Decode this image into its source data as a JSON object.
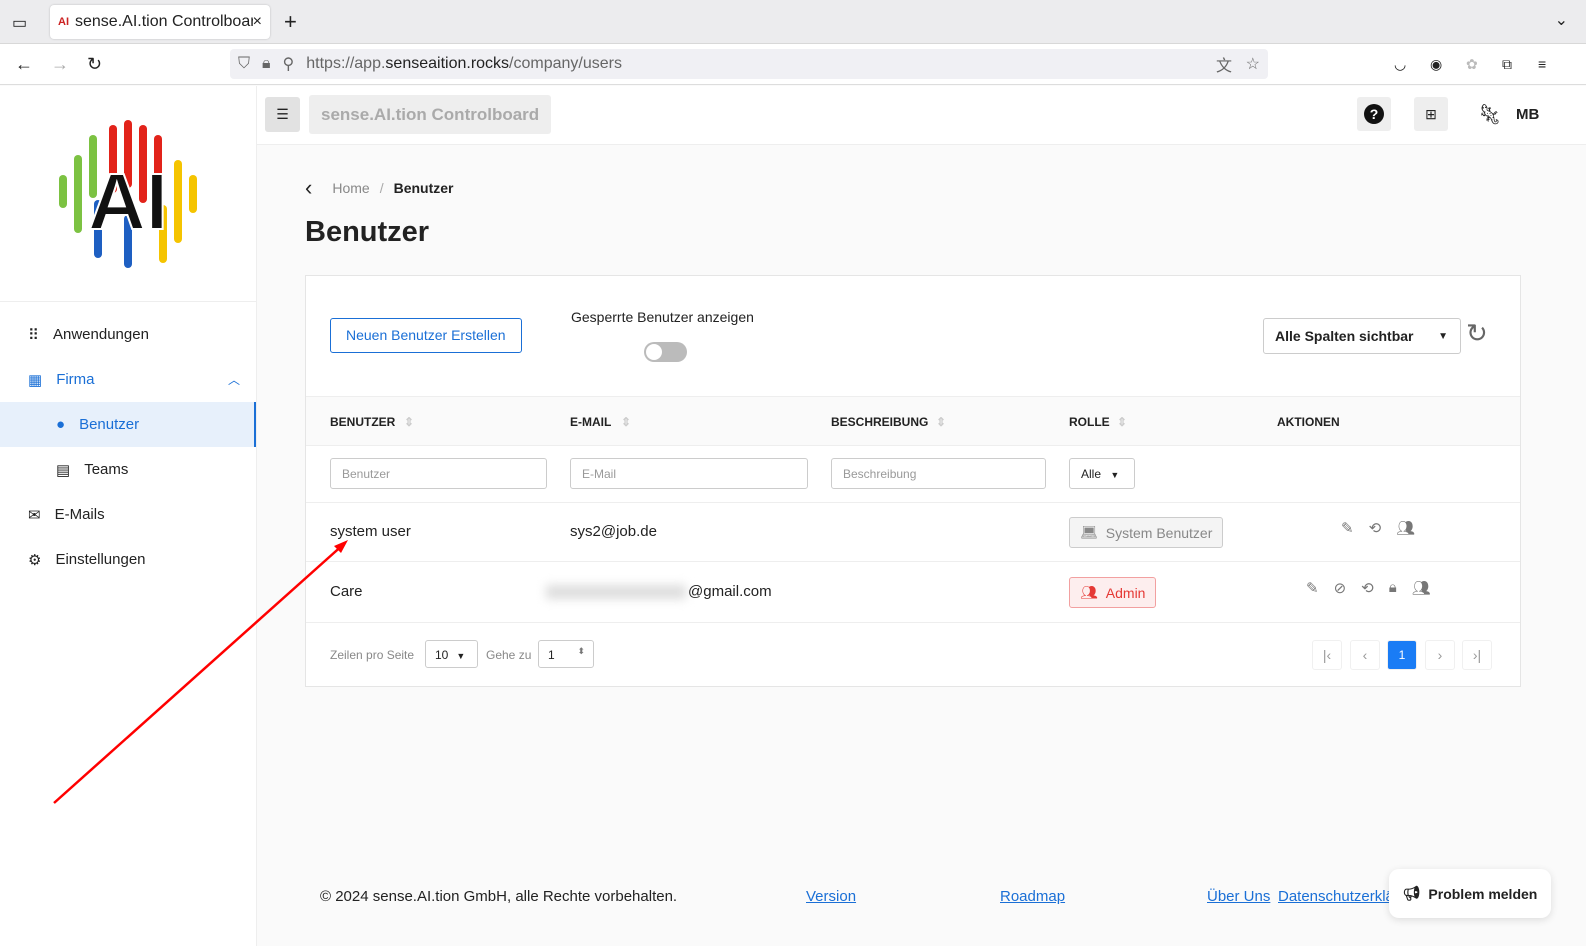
{
  "browser": {
    "tab_title": "sense.AI.tion Controlboard",
    "url_prefix": "https://app.",
    "url_domain": "senseaition.rocks",
    "url_path": "/company/users"
  },
  "header": {
    "app_title": "sense.AI.tion Controlboard",
    "user_initials": "MB"
  },
  "sidebar": {
    "logo_text": "AI",
    "items": [
      {
        "label": "Anwendungen",
        "icon": "apps-icon"
      },
      {
        "label": "Firma",
        "icon": "building-icon"
      },
      {
        "label": "Benutzer",
        "icon": "person-icon"
      },
      {
        "label": "Teams",
        "icon": "list-icon"
      },
      {
        "label": "E-Mails",
        "icon": "mail-icon"
      },
      {
        "label": "Einstellungen",
        "icon": "gear-icon"
      }
    ]
  },
  "breadcrumb": {
    "home": "Home",
    "sep": "/",
    "current": "Benutzer"
  },
  "page_title": "Benutzer",
  "toolbar": {
    "create_button": "Neuen Benutzer Erstellen",
    "toggle_label": "Gesperrte Benutzer anzeigen",
    "toggle_on": false,
    "columns_select": "Alle Spalten sichtbar"
  },
  "table": {
    "headers": [
      "BENUTZER",
      "E-MAIL",
      "BESCHREIBUNG",
      "ROLLE",
      "AKTIONEN"
    ],
    "filters": {
      "user": "Benutzer",
      "email": "E-Mail",
      "description": "Beschreibung",
      "role": "Alle"
    },
    "rows": [
      {
        "user": "system user",
        "email": "sys2@job.de",
        "role": "System Benutzer"
      },
      {
        "user": "Care",
        "email": "@gmail.com",
        "role": "Admin"
      }
    ]
  },
  "pagination": {
    "rows_label": "Zeilen pro Seite",
    "rows_value": "10",
    "goto_label": "Gehe zu",
    "goto_value": "1",
    "current_page": "1"
  },
  "footer": {
    "copyright": "© 2024 sense.AI.tion GmbH, alle Rechte vorbehalten.",
    "links": [
      "Version",
      "Roadmap",
      "Über Uns",
      "Datenschutzerklärung"
    ],
    "report_button": "Problem melden"
  },
  "colors": {
    "accent": "#1a6fd6",
    "admin": "#e53935",
    "annotation_arrow": "#ff0000"
  }
}
